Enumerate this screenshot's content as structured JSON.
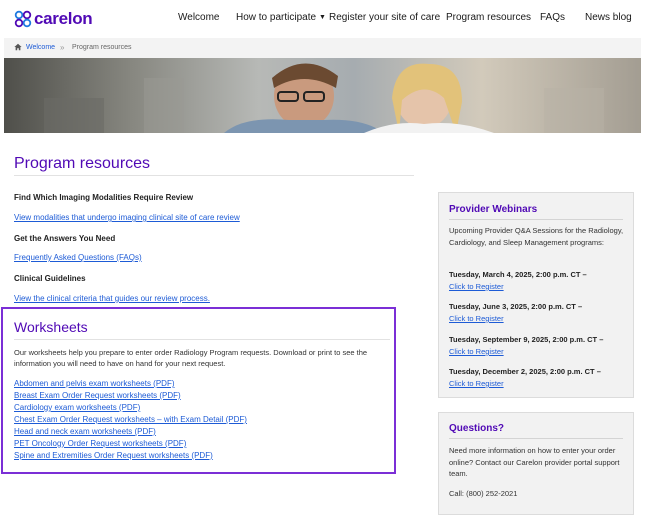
{
  "header": {
    "logo_text": "carelon",
    "brand_color": "#5009b5",
    "nav": [
      {
        "label": "Welcome"
      },
      {
        "label": "How to participate",
        "has_dropdown": true
      },
      {
        "label": "Register your site of care"
      },
      {
        "label": "Program resources"
      },
      {
        "label": "FAQs"
      },
      {
        "label": "News blog"
      }
    ]
  },
  "breadcrumb": {
    "home_icon": "home-icon",
    "items": [
      "Welcome",
      "Program resources"
    ],
    "separator": "»"
  },
  "main": {
    "title": "Program resources",
    "sections": [
      {
        "heading": "Find Which Imaging Modalities Require Review",
        "link": "View modalities that undergo imaging clinical site of care review"
      },
      {
        "heading": "Get the Answers You Need",
        "link": "Frequently Asked Questions (FAQs)"
      },
      {
        "heading": "Clinical Guidelines",
        "link": "View the clinical criteria that guides our review process."
      }
    ],
    "worksheets": {
      "title": "Worksheets",
      "description": "Our worksheets help you prepare to enter order Radiology Program requests. Download or print to see the information you will need to have on hand for your next request.",
      "highlight_color": "#7b2fd6",
      "links": [
        "Abdomen and pelvis exam worksheets (PDF)",
        "Breast Exam Order Request worksheets (PDF)",
        "Cardiology exam worksheets (PDF)",
        "Chest Exam Order Request worksheets – with Exam Detail (PDF)",
        "Head and neck exam worksheets (PDF)",
        "PET Oncology Order Request worksheets (PDF)",
        "Spine and Extremities Order Request worksheets (PDF)"
      ]
    }
  },
  "sidebar": {
    "webinars": {
      "title": "Provider Webinars",
      "intro": "Upcoming Provider Q&A Sessions for the Radiology, Cardiology, and Sleep Management programs:",
      "sessions": [
        {
          "date": "Tuesday, March 4, 2025, 2:00 p.m. CT –",
          "register": "Click to Register"
        },
        {
          "date": "Tuesday, June 3, 2025, 2:00 p.m. CT –",
          "register": "Click to Register"
        },
        {
          "date": "Tuesday, September 9, 2025, 2:00 p.m. CT –",
          "register": "Click to Register"
        },
        {
          "date": "Tuesday, December 2, 2025, 2:00 p.m. CT –",
          "register": "Click to Register"
        }
      ]
    },
    "questions": {
      "title": "Questions?",
      "text": "Need more information on how to enter your order online? Contact our Carelon provider portal support team.",
      "phone": "Call: (800) 252-2021"
    }
  }
}
